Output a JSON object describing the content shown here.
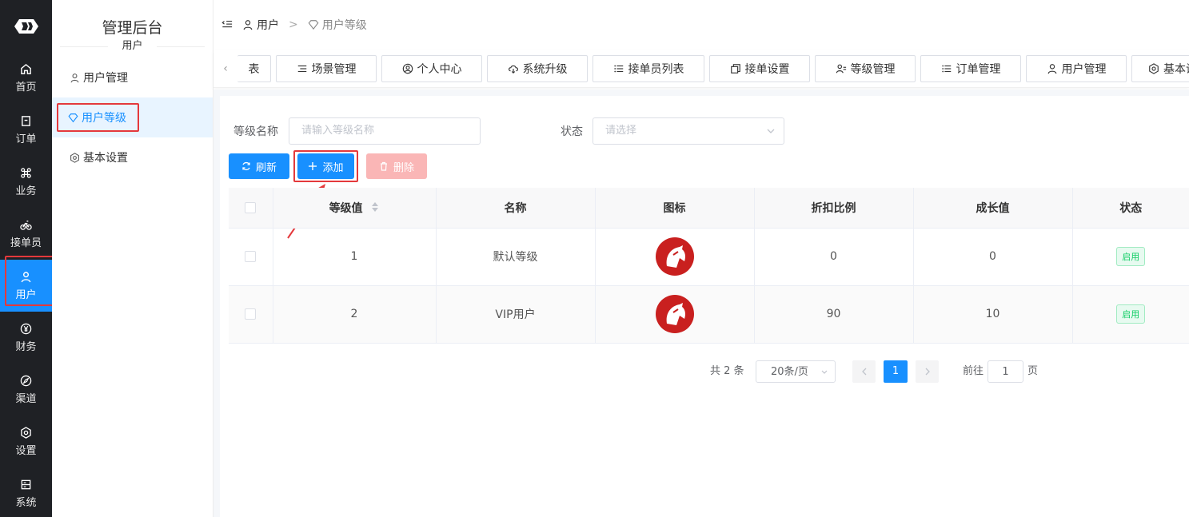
{
  "nav": {
    "items": [
      {
        "label": "首页",
        "icon": "home-icon"
      },
      {
        "label": "订单",
        "icon": "order-icon"
      },
      {
        "label": "业务",
        "icon": "command-icon"
      },
      {
        "label": "接单员",
        "icon": "bicycle-icon"
      },
      {
        "label": "用户",
        "icon": "user-icon"
      },
      {
        "label": "财务",
        "icon": "yen-icon"
      },
      {
        "label": "渠道",
        "icon": "channel-icon"
      },
      {
        "label": "设置",
        "icon": "settings-icon"
      },
      {
        "label": "系统",
        "icon": "system-icon"
      }
    ],
    "active_index": 4
  },
  "subnav": {
    "title": "管理后台",
    "section": "用户",
    "items": [
      {
        "label": "用户管理"
      },
      {
        "label": "用户等级"
      },
      {
        "label": "基本设置"
      }
    ]
  },
  "breadcrumb": {
    "items": [
      "用户",
      "用户等级"
    ],
    "separator": ">"
  },
  "tabs": [
    {
      "label": "表"
    },
    {
      "label": "场景管理"
    },
    {
      "label": "个人中心"
    },
    {
      "label": "系统升级"
    },
    {
      "label": "接单员列表"
    },
    {
      "label": "接单设置"
    },
    {
      "label": "等级管理"
    },
    {
      "label": "订单管理"
    },
    {
      "label": "用户管理"
    },
    {
      "label": "基本设"
    }
  ],
  "filters": {
    "name_label": "等级名称",
    "name_placeholder": "请输入等级名称",
    "status_label": "状态",
    "status_placeholder": "请选择"
  },
  "toolbar": {
    "refresh": "刷新",
    "add": "添加",
    "delete": "删除"
  },
  "table": {
    "headers": [
      "等级值",
      "名称",
      "图标",
      "折扣比例",
      "成长值",
      "状态"
    ],
    "rows": [
      {
        "level": "1",
        "name": "默认等级",
        "discount": "0",
        "growth": "0",
        "status": "启用"
      },
      {
        "level": "2",
        "name": "VIP用户",
        "discount": "90",
        "growth": "10",
        "status": "启用"
      }
    ]
  },
  "pagination": {
    "total": "共 2 条",
    "page_size": "20条/页",
    "current": "1",
    "goto_label": "前往",
    "goto_value": "1",
    "goto_suffix": "页"
  },
  "colors": {
    "primary": "#1890ff",
    "nav_bg": "#1f2125",
    "annotation_red": "#e4393c",
    "status_green": "#13ce66",
    "logo_red": "#c9201f"
  }
}
